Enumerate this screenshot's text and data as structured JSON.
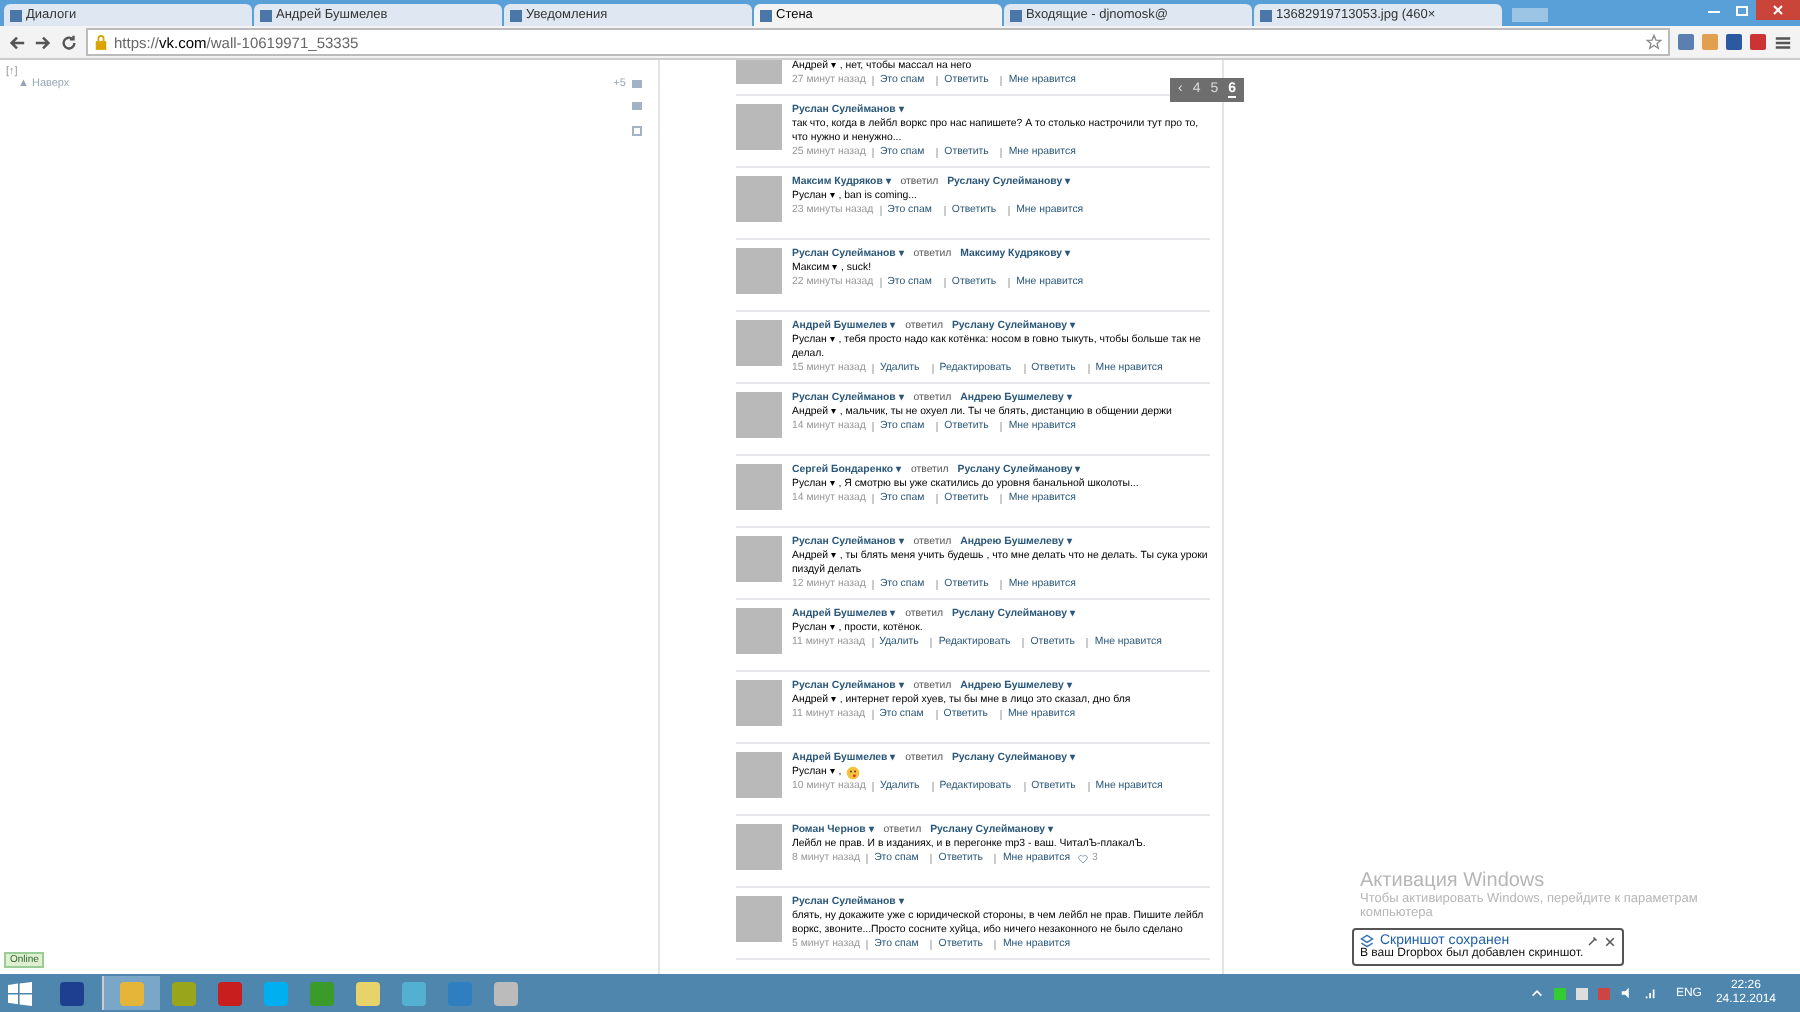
{
  "browser": {
    "tabs": [
      {
        "label": "Диалоги",
        "selected": false
      },
      {
        "label": "Андрей Бушмелев",
        "selected": false
      },
      {
        "label": "Уведомления",
        "selected": false
      },
      {
        "label": "Стена",
        "selected": true
      },
      {
        "label": "Входящие - djnomosk@",
        "selected": false
      },
      {
        "label": "13682919713053.jpg (460×",
        "selected": false
      }
    ],
    "address": "https://**vk.com**/wall-10619971_53335"
  },
  "sidebar": {
    "bracket": "[↑]",
    "up_link": "▲ Наверх",
    "count": "+5"
  },
  "pager": [
    {
      "label": "‹",
      "selected": false
    },
    {
      "label": "4",
      "selected": false
    },
    {
      "label": "5",
      "selected": false
    },
    {
      "label": "6",
      "selected": true
    }
  ],
  "comments": [
    {
      "text": "Андрей ▾ , нет, чтобы массал на него",
      "emoji": false,
      "time": "27 минут назад",
      "actions": [
        "Это спам",
        "Ответить",
        "Мне нравится"
      ]
    },
    {
      "author": "Руслан Сулейманов ▾",
      "text": "так что, когда в лейбл воркс про нас напишете? А то столько настрочили тут про то, что нужно и ненужно...",
      "emoji": false,
      "time": "25 минут назад",
      "actions": [
        "Это спам",
        "Ответить",
        "Мне нравится"
      ]
    },
    {
      "author": "Максим Кудряков ▾",
      "replied": "ответил",
      "reply_to": "Руслану Сулейманову ▾",
      "text": "Руслан ▾ , ban is coming...",
      "emoji": false,
      "time": "23 минуты назад",
      "actions": [
        "Это спам",
        "Ответить",
        "Мне нравится"
      ]
    },
    {
      "author": "Руслан Сулейманов ▾",
      "replied": "ответил",
      "reply_to": "Максиму Кудрякову ▾",
      "text": "Максим ▾ , suck!",
      "emoji": false,
      "time": "22 минуты назад",
      "actions": [
        "Это спам",
        "Ответить",
        "Мне нравится"
      ]
    },
    {
      "author": "Андрей Бушмелев ▾",
      "replied": "ответил",
      "reply_to": "Руслану Сулейманову ▾",
      "text": "Руслан ▾ , тебя просто надо как котёнка: носом в говно тыкуть, чтобы больше так не делал.",
      "emoji": false,
      "time": "15 минут назад",
      "actions": [
        "Удалить",
        "Редактировать",
        "Ответить",
        "Мне нравится"
      ]
    },
    {
      "author": "Руслан Сулейманов ▾",
      "replied": "ответил",
      "reply_to": "Андрею Бушмелеву ▾",
      "text": "Андрей ▾ , мальчик, ты не охуел ли. Ты че блять, дистанцию в общении держи",
      "emoji": false,
      "time": "14 минут назад",
      "actions": [
        "Это спам",
        "Ответить",
        "Мне нравится"
      ]
    },
    {
      "author": "Сергей Бондаренко ▾",
      "replied": "ответил",
      "reply_to": "Руслану Сулейманову ▾",
      "text": "Руслан ▾ , Я смотрю вы уже скатились до уровня банальной школоты...",
      "emoji": false,
      "time": "14 минут назад",
      "actions": [
        "Это спам",
        "Ответить",
        "Мне нравится"
      ]
    },
    {
      "author": "Руслан Сулейманов ▾",
      "replied": "ответил",
      "reply_to": "Андрею Бушмелеву ▾",
      "text": "Андрей ▾ , ты блять меня учить будешь , что мне делать что не делать. Ты сука уроки пиздуй делать",
      "emoji": false,
      "time": "12 минут назад",
      "actions": [
        "Это спам",
        "Ответить",
        "Мне нравится"
      ]
    },
    {
      "author": "Андрей Бушмелев ▾",
      "replied": "ответил",
      "reply_to": "Руслану Сулейманову ▾",
      "text": "Руслан ▾ , прости, котёнок.",
      "emoji": false,
      "time": "11 минут назад",
      "actions": [
        "Удалить",
        "Редактировать",
        "Ответить",
        "Мне нравится"
      ]
    },
    {
      "author": "Руслан Сулейманов ▾",
      "replied": "ответил",
      "reply_to": "Андрею Бушмелеву ▾",
      "text": "Андрей ▾ , интернет герой хуев, ты бы мне в лицо это сказал, дно бля",
      "emoji": false,
      "time": "11 минут назад",
      "actions": [
        "Это спам",
        "Ответить",
        "Мне нравится"
      ]
    },
    {
      "author": "Андрей Бушмелев ▾",
      "replied": "ответил",
      "reply_to": "Руслану Сулейманову ▾",
      "text": "Руслан ▾ ,",
      "emoji": true,
      "time": "10 минут назад",
      "actions": [
        "Удалить",
        "Редактировать",
        "Ответить",
        "Мне нравится"
      ]
    },
    {
      "author": "Роман Чернов ▾",
      "replied": "ответил",
      "reply_to": "Руслану Сулейманову ▾",
      "text": "Лейбл не прав. И в изданиях, и в перегонке mp3 - ваш. ЧиталЪ-плакалЪ.",
      "emoji": false,
      "time": "8 минут назад",
      "actions": [
        "Это спам",
        "Ответить",
        "Мне нравится"
      ],
      "likes": "3"
    },
    {
      "author": "Руслан Сулейманов ▾",
      "text": "блять, ну докажите уже с юридической стороны, в чем лейбл не прав. Пишите лейбл воркс, звоните...Просто сосните хуйца, ибо ничего незаконного не было сделано",
      "emoji": false,
      "time": "5 минут назад",
      "actions": [
        "Это спам",
        "Ответить",
        "Мне нравится"
      ]
    }
  ],
  "activation": {
    "title": "Активация Windows",
    "text": "Чтобы активировать Windows, перейдите к параметрам",
    "text_cut": "компьютера"
  },
  "notification": {
    "title": "Скриншот сохранен",
    "text": "В ваш Dropbox был добавлен скриншот."
  },
  "online_badge": "Online",
  "taskbar": {
    "language": "ENG",
    "time": "22:26",
    "date": "24.12.2014"
  }
}
